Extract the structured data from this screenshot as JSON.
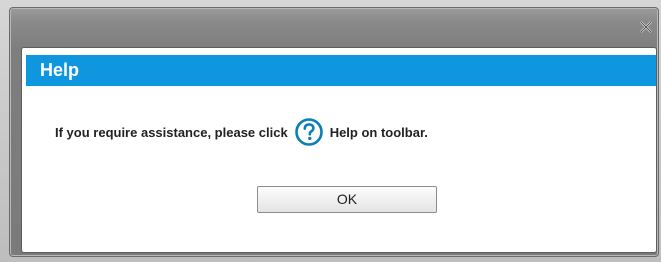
{
  "dialog": {
    "title": "Help",
    "message_before_icon": "If you require assistance, please click",
    "message_after_icon": "Help on toolbar.",
    "ok_label": "OK"
  },
  "icons": {
    "close": "close-icon",
    "help": "help-question-icon"
  },
  "colors": {
    "header_bg": "#0e96de",
    "header_text": "#ffffff",
    "help_icon": "#0b7fb5",
    "frame": "#7e7e7e"
  }
}
